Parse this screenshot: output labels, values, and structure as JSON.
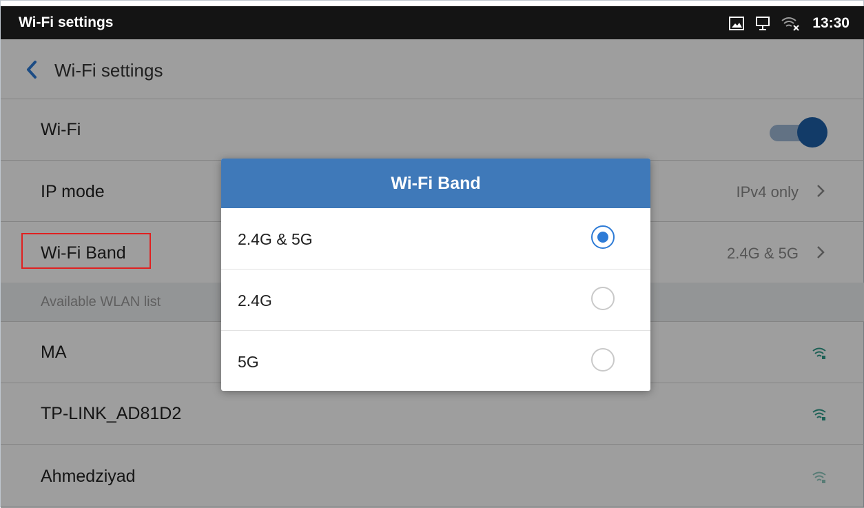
{
  "statusbar": {
    "title": "Wi-Fi settings",
    "time": "13:30",
    "icons": [
      "image-icon",
      "desktop-icon",
      "wifi-off-icon"
    ]
  },
  "header": {
    "title": "Wi-Fi settings"
  },
  "settings": {
    "wifi": {
      "label": "Wi-Fi",
      "enabled": true
    },
    "ip_mode": {
      "label": "IP mode",
      "value": "IPv4 only"
    },
    "wifi_band": {
      "label": "Wi-Fi Band",
      "value": "2.4G & 5G"
    }
  },
  "wlan": {
    "section_label": "Available WLAN list",
    "networks": [
      {
        "ssid": "MA"
      },
      {
        "ssid": "TP-LINK_AD81D2"
      },
      {
        "ssid": "Ahmedziyad"
      }
    ]
  },
  "dialog": {
    "title": "Wi-Fi Band",
    "options": [
      {
        "label": "2.4G & 5G",
        "checked": true
      },
      {
        "label": "2.4G",
        "checked": false
      },
      {
        "label": "5G",
        "checked": false
      }
    ]
  },
  "colors": {
    "statusbar_bg": "#141414",
    "dialog_header": "#3f79b9",
    "radio_accent": "#2e7bd6",
    "highlight": "#e02020"
  }
}
